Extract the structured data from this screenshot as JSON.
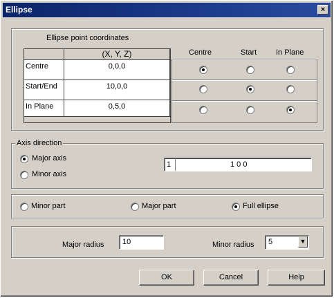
{
  "window": {
    "title": "Ellipse",
    "close_glyph": "×"
  },
  "points_group": {
    "label": "Ellipse point coordinates",
    "column_header": "(X, Y, Z)",
    "rows": [
      {
        "label": "Centre",
        "value": "0,0,0"
      },
      {
        "label": "Start/End",
        "value": "10,0,0"
      },
      {
        "label": "In Plane",
        "value": "0,5,0"
      }
    ],
    "radio_headers": [
      "Centre",
      "Start",
      "In Plane"
    ],
    "radio_selection": [
      [
        true,
        false,
        false
      ],
      [
        false,
        true,
        false
      ],
      [
        false,
        false,
        true
      ]
    ]
  },
  "axis_group": {
    "label": "Axis direction",
    "major_axis_label": "Major axis",
    "minor_axis_label": "Minor axis",
    "major_selected": true,
    "vector_index": "1",
    "vector_value": "1 0 0"
  },
  "part_group": {
    "minor_part_label": "Minor part",
    "major_part_label": "Major part",
    "full_ellipse_label": "Full ellipse",
    "selected": "full_ellipse"
  },
  "radius_group": {
    "major_radius_label": "Major radius",
    "major_radius_value": "10",
    "minor_radius_label": "Minor radius",
    "minor_radius_value": "5"
  },
  "buttons": {
    "ok": "OK",
    "cancel": "Cancel",
    "help": "Help"
  }
}
